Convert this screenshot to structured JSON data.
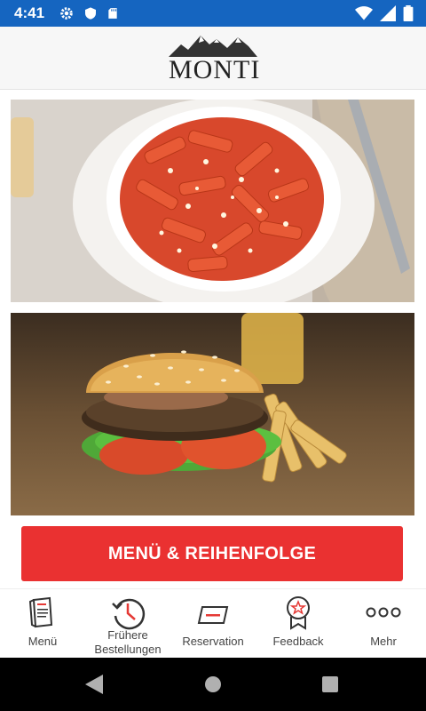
{
  "status_bar": {
    "time": "4:41",
    "left_icons": [
      "gear-icon",
      "shield-icon",
      "sd-card-icon"
    ],
    "right_icons": [
      "wifi-icon",
      "signal-icon",
      "battery-icon"
    ],
    "color": "#1565c0"
  },
  "header": {
    "logo_text": "MONTI"
  },
  "photos": [
    {
      "name": "pasta-photo"
    },
    {
      "name": "burger-photo"
    }
  ],
  "cta": {
    "label": "MENÜ & REIHENFOLGE",
    "color": "#ea3131"
  },
  "tabs": [
    {
      "label": "Menü",
      "icon": "menu-book-icon"
    },
    {
      "label": "Frühere\nBestellungen",
      "icon": "history-icon"
    },
    {
      "label": "Reservation",
      "icon": "ticket-icon"
    },
    {
      "label": "Feedback",
      "icon": "award-icon"
    },
    {
      "label": "Mehr",
      "icon": "more-dots-icon"
    }
  ],
  "accent_color": "#ea3131",
  "nav_bar": {
    "buttons": [
      "back-button",
      "home-button",
      "recents-button"
    ]
  }
}
